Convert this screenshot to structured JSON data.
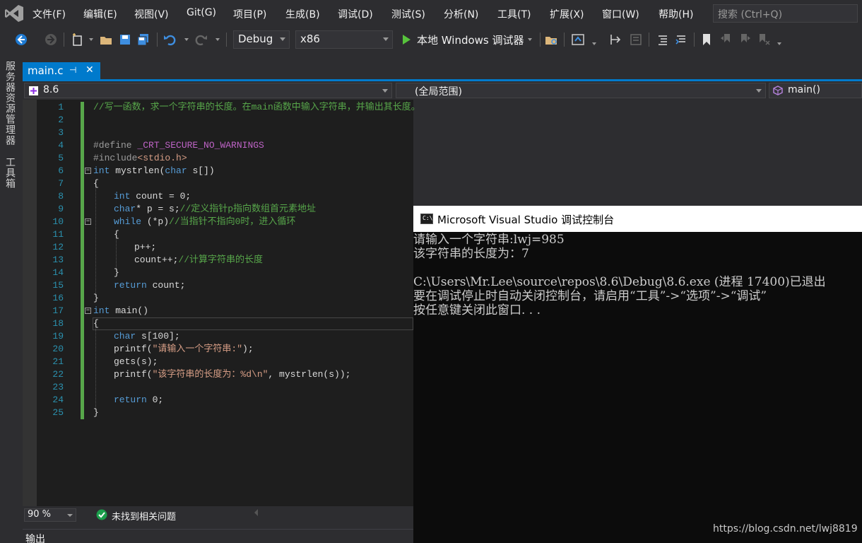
{
  "menu": [
    "文件(F)",
    "编辑(E)",
    "视图(V)",
    "Git(G)",
    "项目(P)",
    "生成(B)",
    "调试(D)",
    "测试(S)",
    "分析(N)",
    "工具(T)",
    "扩展(X)",
    "窗口(W)",
    "帮助(H)"
  ],
  "search": {
    "placeholder": "搜索 (Ctrl+Q)"
  },
  "toolbar": {
    "config": "Debug",
    "platform": "x86",
    "run_label": "本地 Windows 调试器"
  },
  "left_strip": {
    "server_explorer": "服务器资源管理器",
    "toolbox": "工具箱"
  },
  "tab": {
    "label": "main.c",
    "pin": "⊣",
    "close": "✕"
  },
  "navbar": {
    "project": "8.6",
    "scope": "(全局范围)",
    "member": "main()"
  },
  "code": {
    "line_numbers": [
      "1",
      "2",
      "3",
      "4",
      "5",
      "6",
      "7",
      "8",
      "9",
      "10",
      "11",
      "12",
      "13",
      "14",
      "15",
      "16",
      "17",
      "18",
      "19",
      "20",
      "21",
      "22",
      "23",
      "24",
      "25"
    ],
    "l1": "//写一函数，求一个字符串的长度。在main函数中输入字符串，并输出其长度。",
    "l4_a": "#define ",
    "l4_b": "_CRT_SECURE_NO_WARNINGS",
    "l5_a": "#include",
    "l5_b": "<stdio.h>",
    "l6_a": "int",
    "l6_b": " mystrlen(",
    "l6_c": "char",
    "l6_d": " s[])",
    "l7": "{",
    "l8_a": "int",
    "l8_b": " count = 0;",
    "l9_a": "char",
    "l9_b": "* p = s;",
    "l9_c": "//定义指针p指向数组首元素地址",
    "l10_a": "while",
    "l10_b": " (*p)",
    "l10_c": "//当指针不指向0时，进入循环",
    "l11": "{",
    "l12": "p++;",
    "l13_a": "count++;",
    "l13_b": "//计算字符串的长度",
    "l14": "}",
    "l15_a": "return",
    "l15_b": " count;",
    "l16": "}",
    "l17_a": "int",
    "l17_b": " main()",
    "l18": "{",
    "l19_a": "char",
    "l19_b": " s[100];",
    "l20_a": "printf(",
    "l20_b": "\"请输入一个字符串:\"",
    "l20_c": ");",
    "l21": "gets(s);",
    "l22_a": "printf(",
    "l22_b": "\"该字符串的长度为：%d\\n\"",
    "l22_c": ", mystrlen(s));",
    "l24_a": "return",
    "l24_b": " 0;",
    "l25": "}"
  },
  "status": {
    "zoom": "90 %",
    "issues": "未找到相关问题"
  },
  "output": {
    "label": "输出"
  },
  "console": {
    "title": "Microsoft Visual Studio 调试控制台",
    "icon_text": "C:\\",
    "lines": [
      "请输入一个字符串:lwj=985",
      "该字符串的长度为：7",
      "",
      "C:\\Users\\Mr.Lee\\source\\repos\\8.6\\Debug\\8.6.exe (进程 17400)已退出",
      "要在调试停止时自动关闭控制台，请启用“工具”->“选项”->“调试”",
      "按任意键关闭此窗口. . ."
    ]
  },
  "watermark": "https://blog.csdn.net/lwj8819",
  "colors": {
    "accent": "#007acc",
    "editor_bg": "#1e1e1e",
    "chrome_bg": "#2d2d30",
    "comment": "#57a64a",
    "keyword": "#569cd6"
  }
}
